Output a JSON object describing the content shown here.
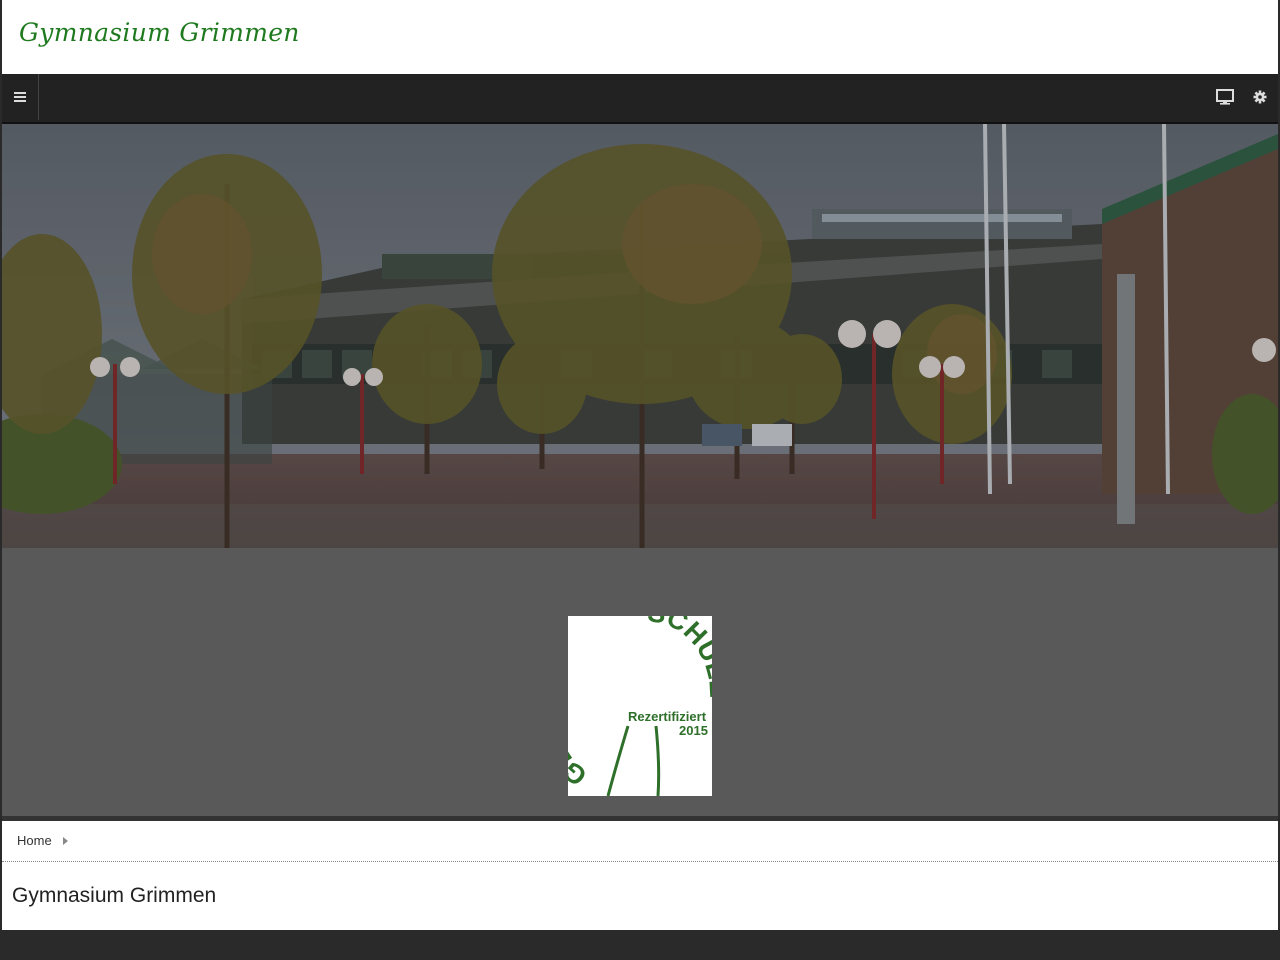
{
  "header": {
    "site_title": "Gymnasium Grimmen"
  },
  "navbar": {
    "menu_icon": "hamburger-menu-icon",
    "right_icons": [
      "desktop-monitor-icon",
      "gear-icon"
    ]
  },
  "hero": {
    "image": "school-building-photo"
  },
  "logo": {
    "arc_text": "GESUNDE SCHULE",
    "line1": "Rezertifiziert",
    "line2": "2015"
  },
  "breadcrumb": {
    "home_label": "Home"
  },
  "main": {
    "page_title": "Gymnasium Grimmen"
  },
  "colors": {
    "brand_green": "#1f7a1f",
    "navbar": "#222222",
    "band": "#595959"
  }
}
